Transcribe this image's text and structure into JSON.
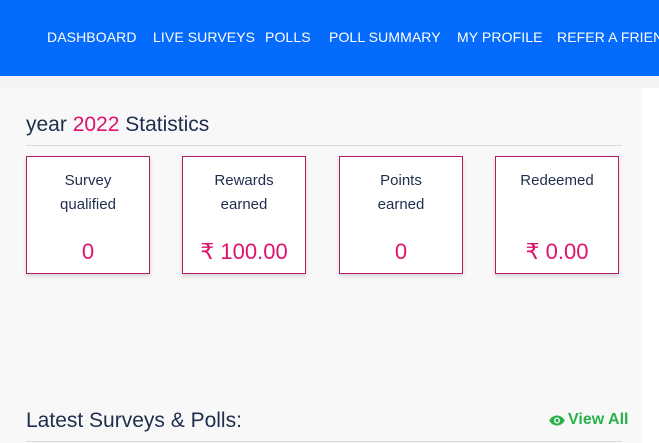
{
  "nav": {
    "items": [
      {
        "label": "DASHBOARD"
      },
      {
        "label": "LIVE SURVEYS"
      },
      {
        "label": "POLLS"
      },
      {
        "label": "POLL SUMMARY"
      },
      {
        "label": "MY PROFILE"
      },
      {
        "label": "REFER A FRIEND"
      }
    ]
  },
  "stats_section": {
    "title_prefix": "year",
    "title_year": "2022",
    "title_suffix": "Statistics"
  },
  "stats": [
    {
      "label": "Survey\nqualified",
      "value": "0"
    },
    {
      "label": "Rewards\nearned",
      "value": "₹ 100.00"
    },
    {
      "label": "Points\nearned",
      "value": "0"
    },
    {
      "label": "Redeemed",
      "value": "₹ 0.00"
    }
  ],
  "latest": {
    "title": "Latest Surveys & Polls:",
    "view_all_label": "View All",
    "view_all_icon": "eye-icon"
  },
  "colors": {
    "nav_bg": "#056bfc",
    "accent": "#e0126e",
    "card_border": "#b21c66",
    "link_green": "#27b34a",
    "text_dark": "#1f2d4d"
  }
}
